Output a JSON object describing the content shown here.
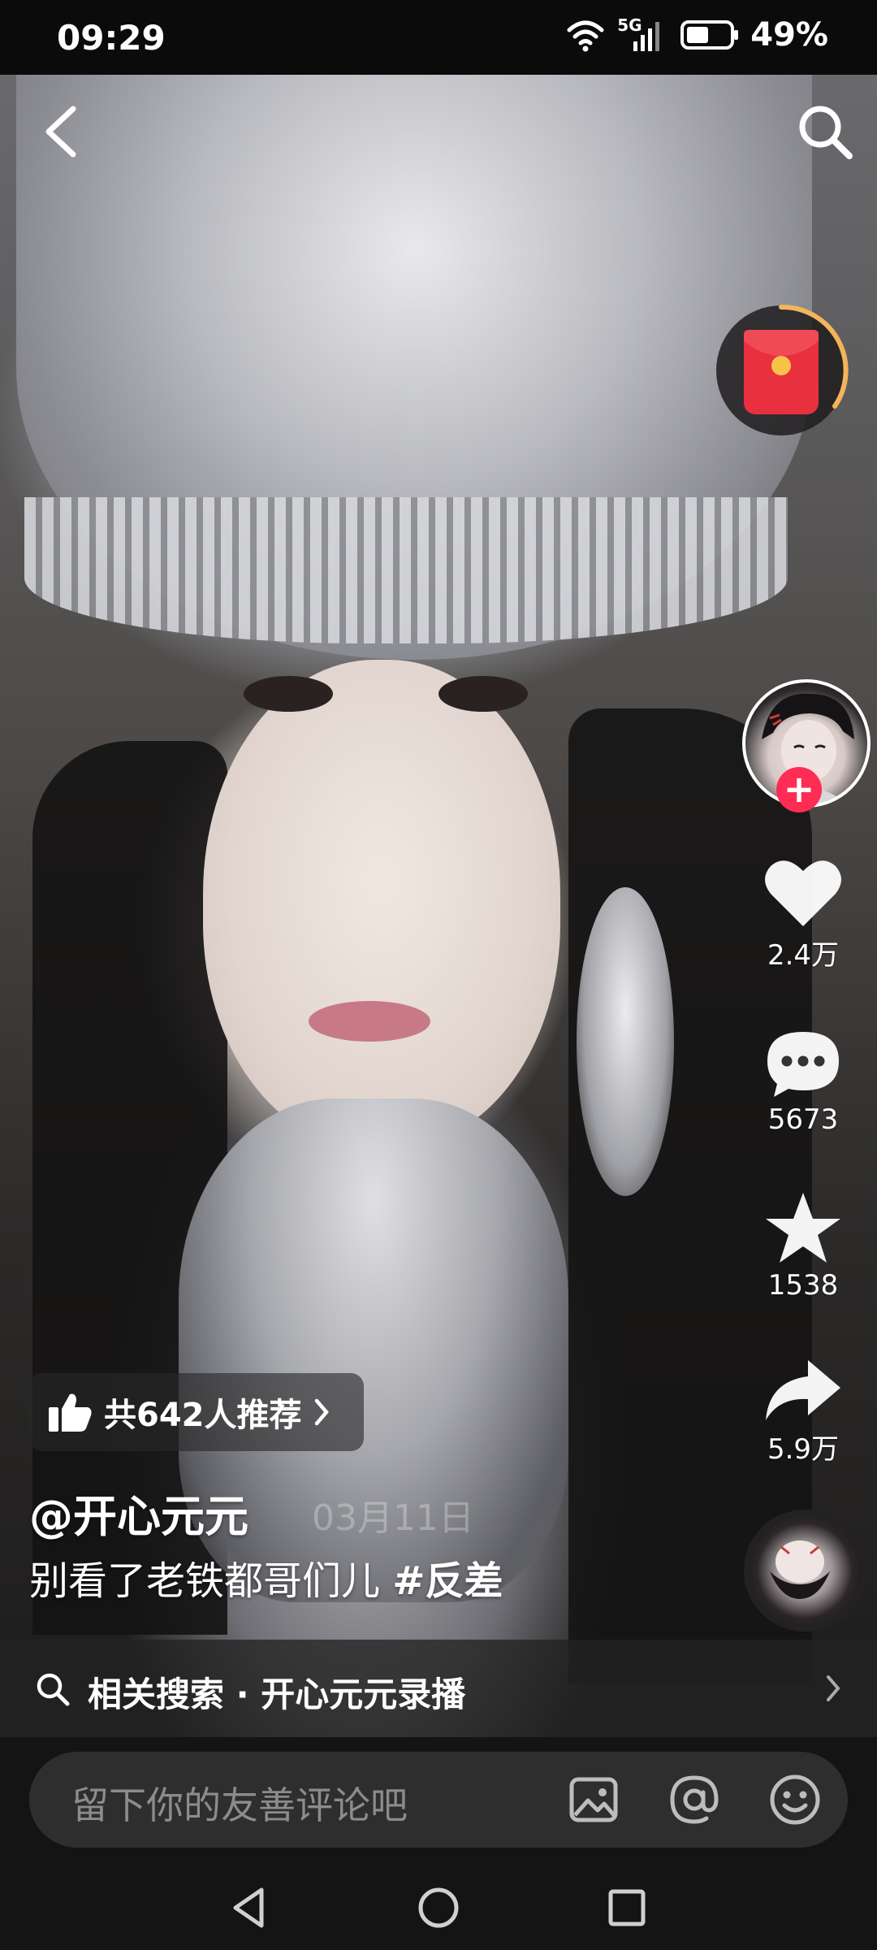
{
  "status_bar": {
    "time": "09:29",
    "network": "5G",
    "battery": "49%"
  },
  "video": {
    "description_icons": [
      "back-icon",
      "search-icon"
    ]
  },
  "right_rail": {
    "like_count": "2.4万",
    "comment_count": "5673",
    "favorite_count": "1538",
    "share_count": "5.9万",
    "follow_symbol": "+"
  },
  "info": {
    "recommend_text": "共642人推荐",
    "author": "@开心元元",
    "date": "03月11日",
    "caption_text": "别看了老铁都哥们儿 ",
    "caption_tag": "#反差"
  },
  "related_search": {
    "text": "相关搜索 · 开心元元录播"
  },
  "comment_bar": {
    "placeholder": "留下你的友善评论吧"
  },
  "colors": {
    "follow_red": "#ff2c55",
    "redpacket_red": "#e8303f",
    "ring_orange": "#f3b45a",
    "background": "#0b0b0b"
  }
}
